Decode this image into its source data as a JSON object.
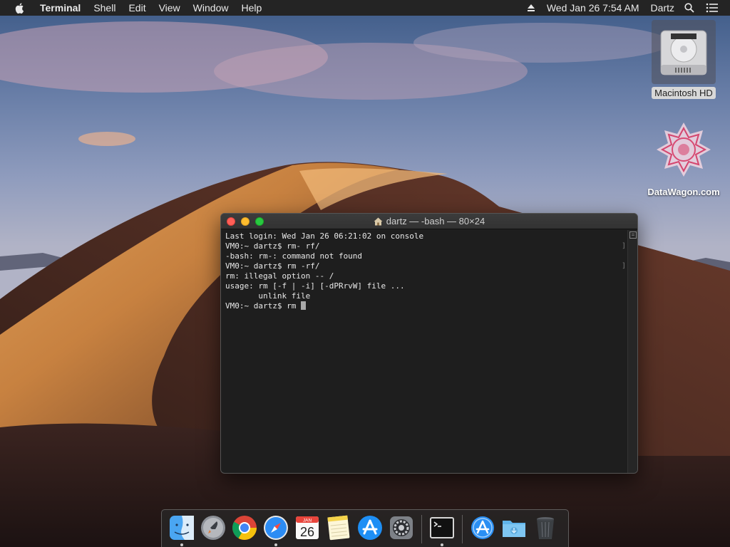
{
  "menubar": {
    "app_name": "Terminal",
    "menus": [
      "Shell",
      "Edit",
      "View",
      "Window",
      "Help"
    ],
    "clock": "Wed Jan 26  7:54 AM",
    "user": "Dartz"
  },
  "desktop": {
    "icons": [
      {
        "label": "Macintosh HD",
        "icon": "hard-drive-icon"
      },
      {
        "label": "DataWagon.com",
        "icon": "datawagon-logo-icon"
      }
    ]
  },
  "terminal": {
    "title": "dartz — -bash — 80×24",
    "lines": [
      "Last login: Wed Jan 26 06:21:02 on console",
      "VM0:~ dartz$ rm- rf/",
      "-bash: rm-: command not found",
      "VM0:~ dartz$ rm -rf/",
      "rm: illegal option -- /",
      "usage: rm [-f | -i] [-dPRrvW] file ...",
      "       unlink file",
      "VM0:~ dartz$ rm "
    ]
  },
  "dock": {
    "items": [
      {
        "name": "Finder",
        "icon": "finder-icon",
        "running": true
      },
      {
        "name": "Launchpad",
        "icon": "launchpad-icon",
        "running": false
      },
      {
        "name": "Google Chrome",
        "icon": "chrome-icon",
        "running": false
      },
      {
        "name": "Safari",
        "icon": "safari-icon",
        "running": true
      },
      {
        "name": "Calendar",
        "icon": "calendar-icon",
        "running": false,
        "month": "JAN",
        "day": "26"
      },
      {
        "name": "Notes",
        "icon": "notes-icon",
        "running": false
      },
      {
        "name": "App Store",
        "icon": "app-store-icon",
        "running": false
      },
      {
        "name": "System Preferences",
        "icon": "system-preferences-icon",
        "running": false
      },
      {
        "name": "Terminal",
        "icon": "terminal-icon",
        "running": true
      },
      {
        "name": "Applications",
        "icon": "applications-folder-icon",
        "running": false
      },
      {
        "name": "Downloads",
        "icon": "downloads-folder-icon",
        "running": false
      },
      {
        "name": "Trash",
        "icon": "trash-icon",
        "running": false
      }
    ]
  },
  "colors": {
    "menubar_bg": "#242424",
    "terminal_bg": "#1e1e1e",
    "terminal_text": "#e8e8e8",
    "close": "#fe5f57",
    "minimize": "#febc2e",
    "zoom": "#28c840"
  }
}
